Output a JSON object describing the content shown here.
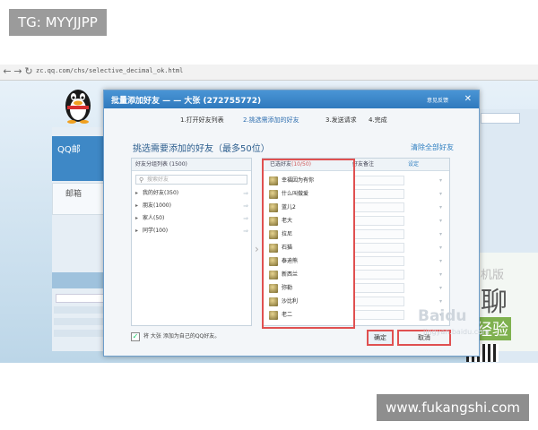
{
  "watermarks": {
    "top": "TG: MYYJJPP",
    "bottom": "www.fukangshi.com"
  },
  "browser": {
    "url": "zc.qq.com/chs/selective_decimal_ok.html",
    "back_icon": "left-arrow-icon",
    "forward_icon": "right-arrow-icon",
    "refresh_icon": "refresh-icon"
  },
  "background_page": {
    "qq_mail_label": "QQ邮",
    "mail_label": "邮箱",
    "promo_line1": "机版",
    "promo_line2": "聊",
    "promo_line3": "经验"
  },
  "dialog": {
    "title": "批量添加好友 — — 大张 (272755772)",
    "feedback": "意见反馈",
    "close_icon": "close-icon",
    "steps": [
      "1.打开好友列表",
      "2.挑选需添加的好友",
      "3.发送请求",
      "4.完成"
    ],
    "instruction": "挑选需要添加的好友（最多50位）",
    "remove_all": "清除全部好友",
    "left_list": {
      "header": "好友分组列表 (1500)",
      "search_placeholder": "搜索好友",
      "groups": [
        "我的好友(350)",
        "朋友(1000)",
        "家人(50)",
        "同学(100)"
      ]
    },
    "right_list": {
      "header_selected": "已选好友",
      "header_count": "(10/50)",
      "header_remark": "好友备注",
      "header_group": "设定",
      "friends": [
        "幸福因为有你",
        "什么叫做爱",
        "蓝儿2",
        "老大",
        "拉尼",
        "石猫",
        "泰迪熊",
        "新西兰",
        "弥勒",
        "沙比利",
        "老二"
      ]
    },
    "footer_checkbox": "✓",
    "footer_text": "将 大张 添加为自己的QQ好友。",
    "ok_button": "确定",
    "cancel_button": "取消"
  },
  "baidu": {
    "logo": "Baidu",
    "sub": "jingyan.baidu.com"
  }
}
